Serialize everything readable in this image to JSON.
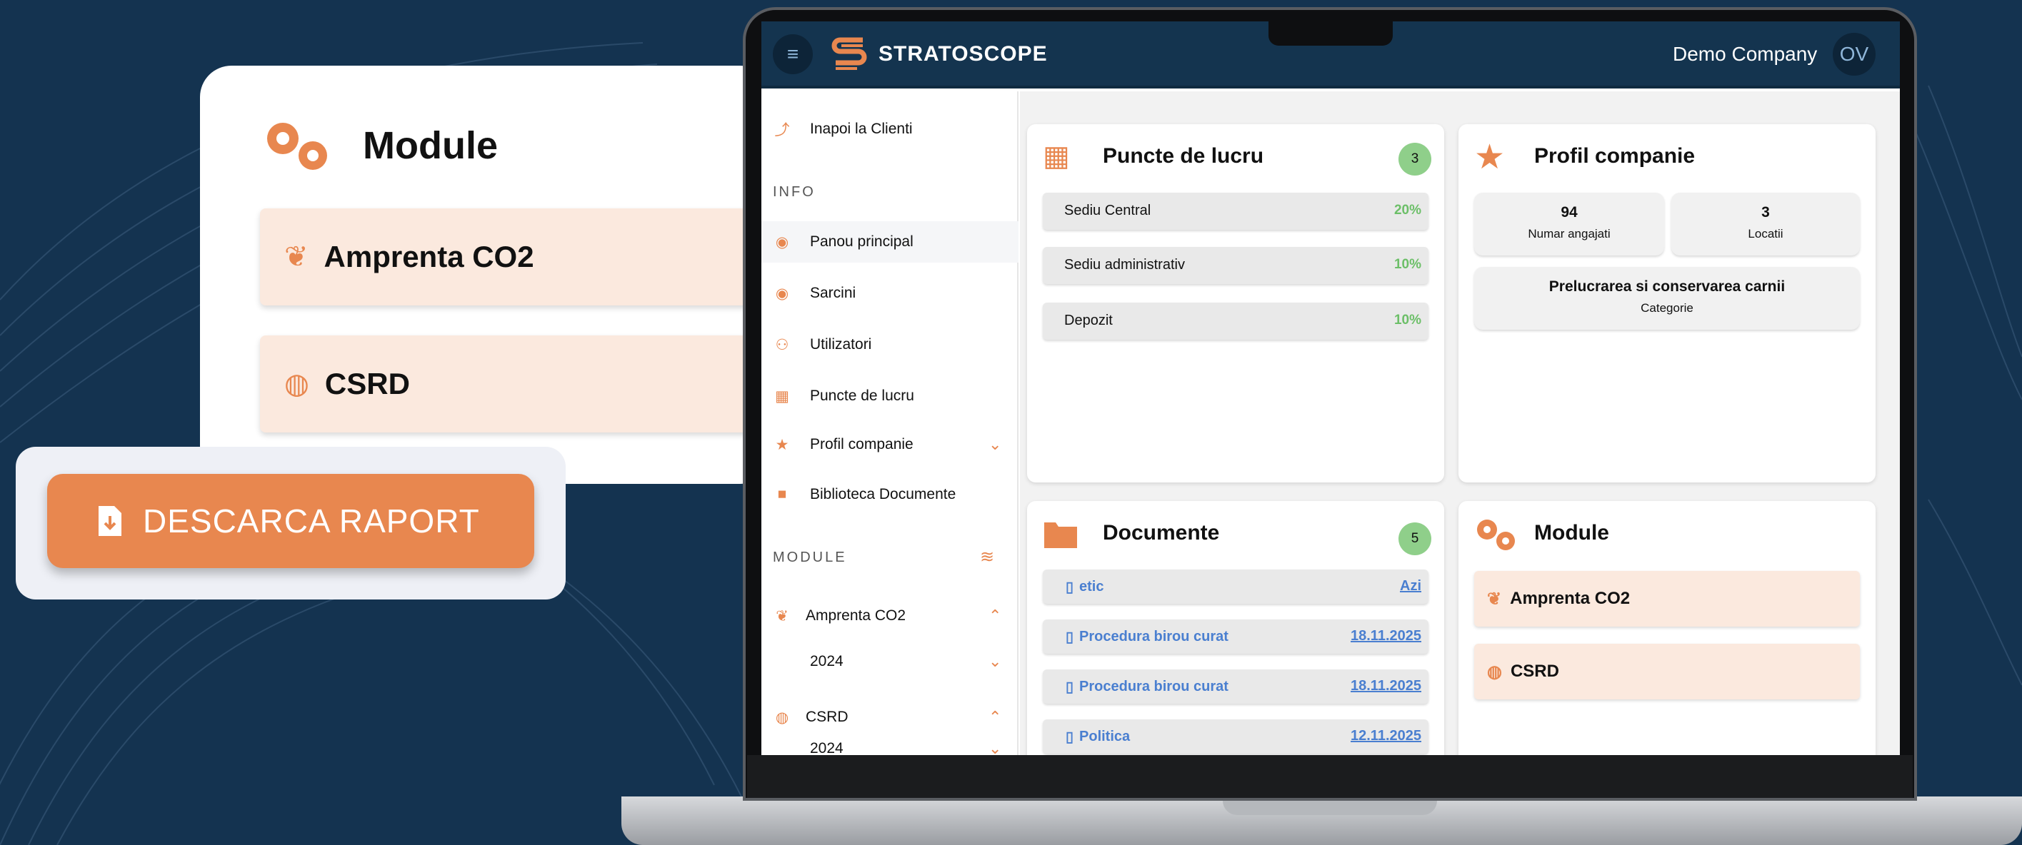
{
  "float_card": {
    "title": "Module",
    "items": [
      {
        "label": "Amprenta CO2",
        "icon": "leaf-icon"
      },
      {
        "label": "CSRD",
        "icon": "globe-icon"
      }
    ]
  },
  "download": {
    "label": "DESCARCA RAPORT",
    "icon": "file-download-icon"
  },
  "app": {
    "brand": "STRATOSCOPE",
    "company": "Demo Company",
    "avatar": "OV",
    "menu_icon": "≡"
  },
  "sidebar": {
    "back": "Inapoi la Clienti",
    "section_info": "INFO",
    "items": [
      {
        "label": "Panou principal",
        "icon": "dashboard-icon"
      },
      {
        "label": "Sarcini",
        "icon": "tasks-icon"
      },
      {
        "label": "Utilizatori",
        "icon": "users-icon"
      },
      {
        "label": "Puncte de lucru",
        "icon": "building-icon"
      },
      {
        "label": "Profil companie",
        "icon": "star-icon"
      },
      {
        "label": "Biblioteca Documente",
        "icon": "folder-icon"
      }
    ],
    "section_module": "MODULE",
    "modules": [
      {
        "label": "Amprenta CO2",
        "year": "2024"
      },
      {
        "label": "CSRD",
        "year": "2024"
      }
    ]
  },
  "puncte": {
    "title": "Puncte de lucru",
    "count": "3",
    "rows": [
      {
        "name": "Sediu Central",
        "pct": "20%"
      },
      {
        "name": "Sediu administrativ",
        "pct": "10%"
      },
      {
        "name": "Depozit",
        "pct": "10%"
      }
    ]
  },
  "profil": {
    "title": "Profil companie",
    "stats": [
      {
        "value": "94",
        "label": "Numar angajati"
      },
      {
        "value": "3",
        "label": "Locatii"
      }
    ],
    "category": {
      "value": "Prelucrarea si conservarea carnii",
      "label": "Categorie"
    }
  },
  "documente": {
    "title": "Documente",
    "count": "5",
    "rows": [
      {
        "name": "etic",
        "date": "Azi"
      },
      {
        "name": "Procedura birou curat",
        "date": "18.11.2025"
      },
      {
        "name": "Procedura birou curat",
        "date": "18.11.2025"
      },
      {
        "name": "Politica",
        "date": "12.11.2025"
      }
    ]
  },
  "module_card": {
    "title": "Module",
    "items": [
      "Amprenta CO2",
      "CSRD"
    ]
  },
  "colors": {
    "accent": "#e8874f",
    "navy": "#143350",
    "badge": "#8fcf8a"
  }
}
